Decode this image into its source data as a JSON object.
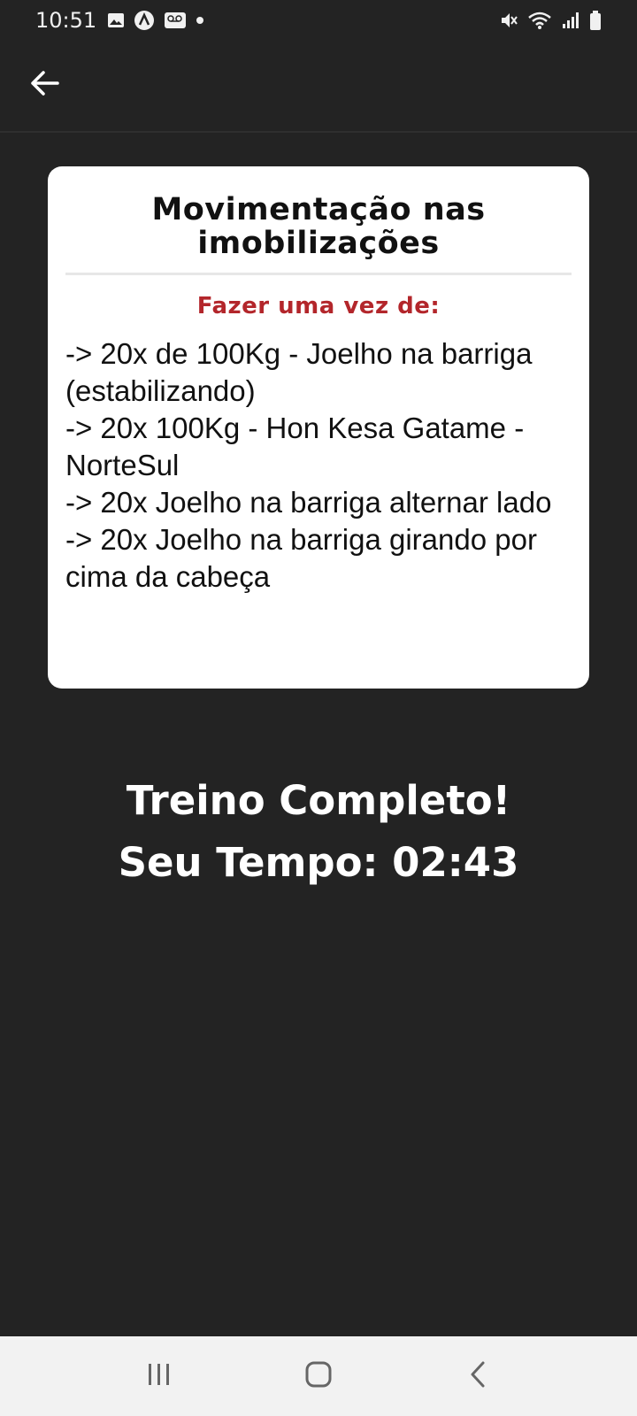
{
  "status_bar": {
    "time": "10:51",
    "icons_left": [
      "gallery-icon",
      "app-icon",
      "voicemail-icon",
      "dot-icon"
    ],
    "icons_right": [
      "mute-icon",
      "wifi-icon",
      "signal-icon",
      "battery-icon"
    ]
  },
  "app_bar": {
    "back_icon": "arrow-left-icon"
  },
  "card": {
    "title": "Movimentação nas imobilizações",
    "subtitle": "Fazer uma vez de:",
    "lines": [
      "-> 20x de 100Kg - Joelho na barriga (estabilizando)",
      "-> 20x 100Kg - Hon Kesa Gatame - NorteSul",
      "-> 20x Joelho na barriga alternar lado",
      "-> 20x Joelho na barriga girando por cima da cabeça"
    ],
    "subtitle_color": "#b3262b"
  },
  "result": {
    "title": "Treino Completo!",
    "time_text": "Seu Tempo: 02:43"
  },
  "nav_bar": {
    "recent_icon": "recent-apps-icon",
    "home_icon": "home-icon",
    "back_icon": "back-icon"
  },
  "colors": {
    "background": "#232323",
    "card": "#ffffff",
    "accent": "#b3262b",
    "nav_bar": "#f2f2f2"
  }
}
